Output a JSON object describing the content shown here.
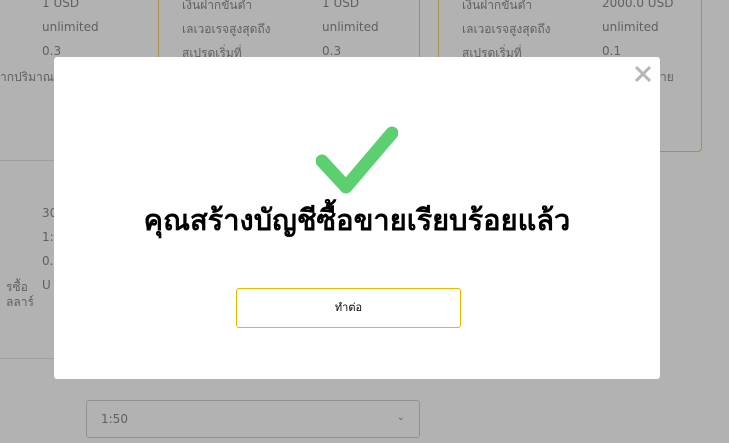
{
  "background": {
    "card1": {
      "values": [
        "1 USD",
        "unlimited",
        "0.3"
      ],
      "cut_label": "ากปริมาณ"
    },
    "card2": {
      "labels": [
        "เงินฝากขั้นต่ำ",
        "เลเวอเรจสูงสุดถึง",
        "สเปรดเริ่มที่"
      ],
      "values": [
        "1 USD",
        "unlimited",
        "0.3"
      ]
    },
    "card3": {
      "labels": [
        "เงินฝากขั้นต่ำ",
        "เลเวอเรจสูงสุดถึง",
        "สเปรดเริ่มที่"
      ],
      "values": [
        "2000.0 USD",
        "unlimited",
        "0.1"
      ],
      "cut_label": "าย"
    },
    "lower_left": {
      "labels": [
        "รซื้อ",
        "ลลาร์"
      ]
    },
    "lower_values": [
      "30",
      "1:",
      "0.",
      "U"
    ],
    "select": {
      "value": "1:50",
      "caret": "⌄"
    }
  },
  "modal": {
    "close_icon": "close-icon",
    "check_icon": "checkmark-icon",
    "check_color": "#5ccf71",
    "title": "คุณสร้างบัญชีซื้อขายเรียบร้อยแล้ว",
    "continue_label": "ทำต่อ",
    "button_border_color": "#e6b800"
  }
}
